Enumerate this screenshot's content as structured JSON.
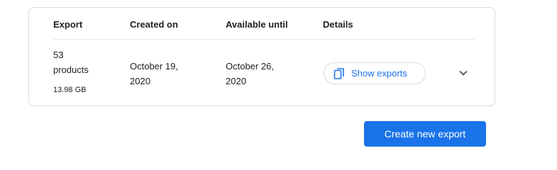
{
  "table": {
    "headers": {
      "export": "Export",
      "created_on": "Created on",
      "available_until": "Available until",
      "details": "Details"
    },
    "row": {
      "export_count": "53",
      "export_unit": "products",
      "size": "13.98 GB",
      "created_line1": "October 19,",
      "created_line2": "2020",
      "available_line1": "October 26,",
      "available_line2": "2020",
      "show_exports_label": "Show exports"
    }
  },
  "actions": {
    "create_label": "Create new export"
  },
  "icons": {
    "copy": "copy-icon",
    "expand": "chevron-down-icon"
  },
  "colors": {
    "accent": "#1a73e8",
    "border": "#dadce0"
  }
}
